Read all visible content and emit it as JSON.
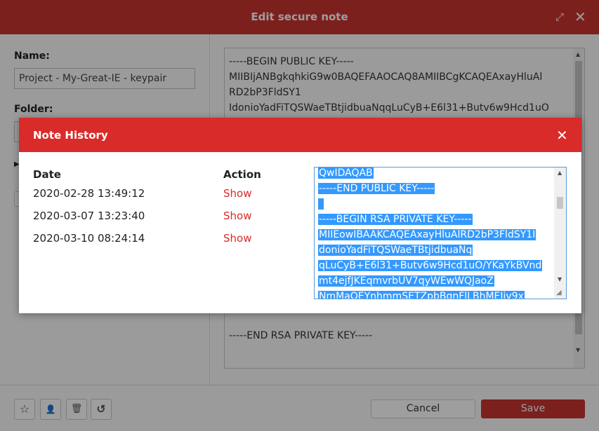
{
  "window": {
    "title": "Edit secure note",
    "expand_icon": "⤢",
    "close_icon": "✕"
  },
  "form": {
    "name_label": "Name:",
    "name_value": "Project - My-Great-IE - keypair",
    "folder_label": "Folder:"
  },
  "note": {
    "lines": [
      "-----BEGIN PUBLIC KEY-----",
      "MIIBIjANBgkqhkiG9w0BAQEFAAOCAQ8AMIIBCgKCAQEAxayHluAl",
      "RD2bP3FldSY1",
      "IdonioYadFiTQSWaeTBtjidbuaNqqLuCyB+E6l31+Butv6w9Hcd1uO"
    ],
    "end_line": "-----END RSA PRIVATE KEY-----"
  },
  "footer": {
    "favorite_icon": "☆",
    "share_icon": "👤",
    "delete_icon": "🗑",
    "history_icon": "↺",
    "cancel_label": "Cancel",
    "save_label": "Save"
  },
  "dialog": {
    "title": "Note History",
    "close_icon": "✕",
    "col_date": "Date",
    "col_action": "Action",
    "history": [
      {
        "date": "2020-02-28 13:49:12",
        "action": "Show"
      },
      {
        "date": "2020-03-07 13:23:40",
        "action": "Show"
      },
      {
        "date": "2020-03-10 08:24:14",
        "action": "Show"
      }
    ],
    "content_lines": [
      "QwIDAQAB",
      "-----END PUBLIC KEY-----",
      " ",
      "-----BEGIN RSA PRIVATE KEY-----",
      "MIIEowIBAAKCAQEAxayHluAlRD2bP3FldSY1I",
      "donioYadFiTQSWaeTBtjidbuaNq",
      "qLuCyB+E6l31+Butv6w9Hcd1uO/YKaYkBVnd",
      "mt4ejfJKEqmvrbUV7qyWEwWQJaoZ",
      "NmMaQEYnhmmSETZpbBqnFlLBhMEIiv9x"
    ]
  },
  "colors": {
    "header_red": "#c93431",
    "dialog_red": "#d92b29",
    "selection_blue": "#3399ff"
  }
}
